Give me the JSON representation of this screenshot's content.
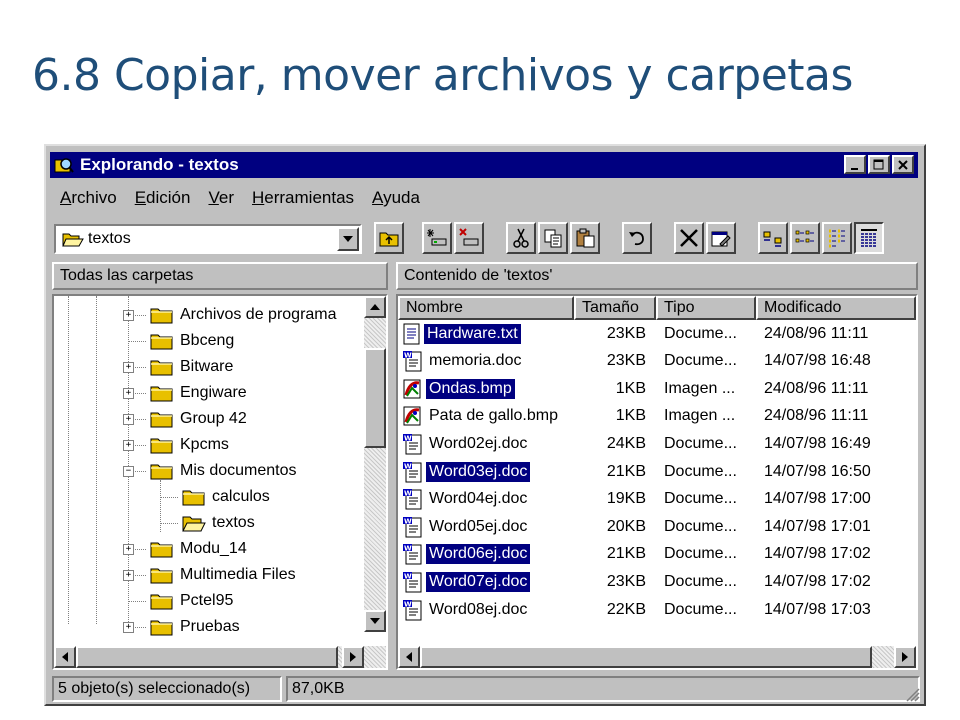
{
  "slide_title": "6.8 Copiar, mover archivos y carpetas",
  "window": {
    "title": "Explorando - textos",
    "controls": [
      "minimize-icon",
      "maximize-icon",
      "close-icon"
    ]
  },
  "menu": [
    "Archivo",
    "Edición",
    "Ver",
    "Herramientas",
    "Ayuda"
  ],
  "address": {
    "value": "textos"
  },
  "toolbar_icons": [
    "up-folder-icon",
    "map-drive-icon",
    "disconnect-drive-icon",
    "cut-icon",
    "copy-icon",
    "paste-icon",
    "undo-icon",
    "delete-icon",
    "properties-icon",
    "large-icons-view-icon",
    "small-icons-view-icon",
    "list-view-icon",
    "details-view-icon"
  ],
  "tree": {
    "header": "Todas las carpetas",
    "items": [
      {
        "label": "Archivos de programa",
        "level": 1,
        "expander": "+"
      },
      {
        "label": "Bbceng",
        "level": 1,
        "expander": ""
      },
      {
        "label": "Bitware",
        "level": 1,
        "expander": "+"
      },
      {
        "label": "Engiware",
        "level": 1,
        "expander": "+"
      },
      {
        "label": "Group 42",
        "level": 1,
        "expander": "+"
      },
      {
        "label": "Kpcms",
        "level": 1,
        "expander": "+"
      },
      {
        "label": "Mis documentos",
        "level": 1,
        "expander": "−"
      },
      {
        "label": "calculos",
        "level": 2,
        "expander": ""
      },
      {
        "label": "textos",
        "level": 2,
        "expander": "",
        "open": true
      },
      {
        "label": "Modu_14",
        "level": 1,
        "expander": "+"
      },
      {
        "label": "Multimedia Files",
        "level": 1,
        "expander": "+"
      },
      {
        "label": "Pctel95",
        "level": 1,
        "expander": ""
      },
      {
        "label": "Pruebas",
        "level": 1,
        "expander": "+"
      }
    ]
  },
  "list": {
    "header": "Contenido de 'textos'",
    "columns": [
      "Nombre",
      "Tamaño",
      "Tipo",
      "Modificado"
    ],
    "rows": [
      {
        "name": "Hardware.txt",
        "size": "23KB",
        "type": "Docume...",
        "modified": "24/08/96 11:11",
        "icon": "text-file-icon",
        "selected": true
      },
      {
        "name": "memoria.doc",
        "size": "23KB",
        "type": "Docume...",
        "modified": "14/07/98 16:48",
        "icon": "word-doc-icon",
        "selected": false
      },
      {
        "name": "Ondas.bmp",
        "size": "1KB",
        "type": "Imagen ...",
        "modified": "24/08/96 11:11",
        "icon": "bitmap-image-icon",
        "selected": true
      },
      {
        "name": "Pata de gallo.bmp",
        "size": "1KB",
        "type": "Imagen ...",
        "modified": "24/08/96 11:11",
        "icon": "bitmap-image-icon",
        "selected": false
      },
      {
        "name": "Word02ej.doc",
        "size": "24KB",
        "type": "Docume...",
        "modified": "14/07/98 16:49",
        "icon": "word-doc-icon",
        "selected": false
      },
      {
        "name": "Word03ej.doc",
        "size": "21KB",
        "type": "Docume...",
        "modified": "14/07/98 16:50",
        "icon": "word-doc-icon",
        "selected": true
      },
      {
        "name": "Word04ej.doc",
        "size": "19KB",
        "type": "Docume...",
        "modified": "14/07/98 17:00",
        "icon": "word-doc-icon",
        "selected": false
      },
      {
        "name": "Word05ej.doc",
        "size": "20KB",
        "type": "Docume...",
        "modified": "14/07/98 17:01",
        "icon": "word-doc-icon",
        "selected": false
      },
      {
        "name": "Word06ej.doc",
        "size": "21KB",
        "type": "Docume...",
        "modified": "14/07/98 17:02",
        "icon": "word-doc-icon",
        "selected": true
      },
      {
        "name": "Word07ej.doc",
        "size": "23KB",
        "type": "Docume...",
        "modified": "14/07/98 17:02",
        "icon": "word-doc-icon",
        "selected": true
      },
      {
        "name": "Word08ej.doc",
        "size": "22KB",
        "type": "Docume...",
        "modified": "14/07/98 17:03",
        "icon": "word-doc-icon",
        "selected": false
      }
    ]
  },
  "status": {
    "selection": "5 objeto(s) seleccionado(s)",
    "size": "87,0KB"
  },
  "colors": {
    "title_text": "#1f4e79",
    "titlebar": "#000080",
    "selection": "#000080",
    "chrome": "#c0c0c0"
  }
}
